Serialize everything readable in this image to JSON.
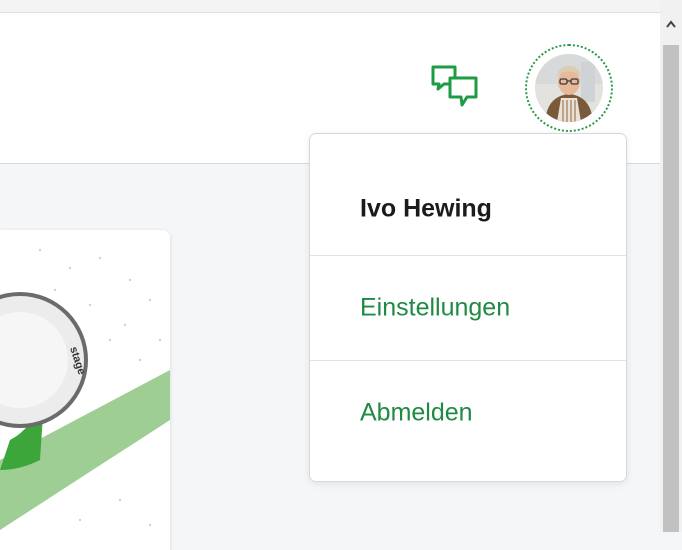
{
  "header": {
    "chat_icon": "chat-bubbles-icon",
    "avatar_icon": "user-avatar"
  },
  "user_menu": {
    "name": "Ivo Hewing",
    "items": [
      {
        "label": "Einstellungen"
      },
      {
        "label": "Abmelden"
      }
    ]
  },
  "card": {
    "badge_text": "stage",
    "badge_icon": "check-seal-icon"
  },
  "colors": {
    "accent": "#1f8a43",
    "icon_green": "#1e9b45",
    "ring": "#2a9a48"
  }
}
